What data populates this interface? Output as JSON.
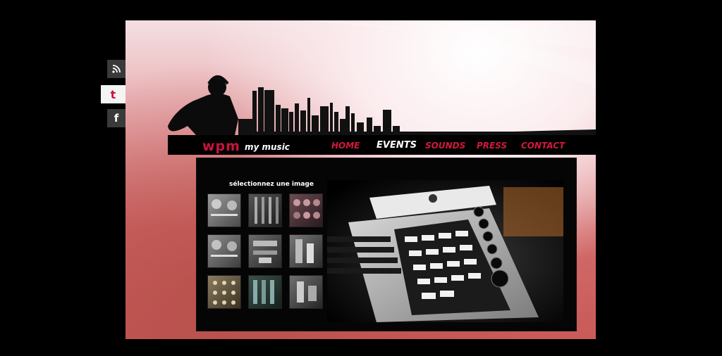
{
  "social": {
    "items": [
      {
        "name": "rss",
        "icon": "rss-icon"
      },
      {
        "name": "tumblr",
        "icon": "tumblr-icon",
        "glyph": "t"
      },
      {
        "name": "facebook",
        "icon": "facebook-icon",
        "glyph": "f"
      }
    ]
  },
  "header": {
    "logo_text": "wpm",
    "tagline": "my music"
  },
  "nav": {
    "home": "HOME",
    "events": "EVENTS",
    "sounds": "SOUNDS",
    "press": "PRESS",
    "contact": "CONTACT",
    "active": "EVENTS"
  },
  "gallery": {
    "title": "sélectionnez une image",
    "thumbnails": [
      {
        "subject": "mixer-knobs-aux"
      },
      {
        "subject": "fader-strip"
      },
      {
        "subject": "pink-knobs"
      },
      {
        "subject": "mixer-knobs-aux"
      },
      {
        "subject": "faders-red"
      },
      {
        "subject": "faders-close"
      },
      {
        "subject": "patch-jacks"
      },
      {
        "subject": "console-meters"
      },
      {
        "subject": "fader-close"
      }
    ],
    "main_image": "midi-controller-keyboard"
  },
  "colors": {
    "accent": "#d11a3a",
    "background": "#000000"
  }
}
